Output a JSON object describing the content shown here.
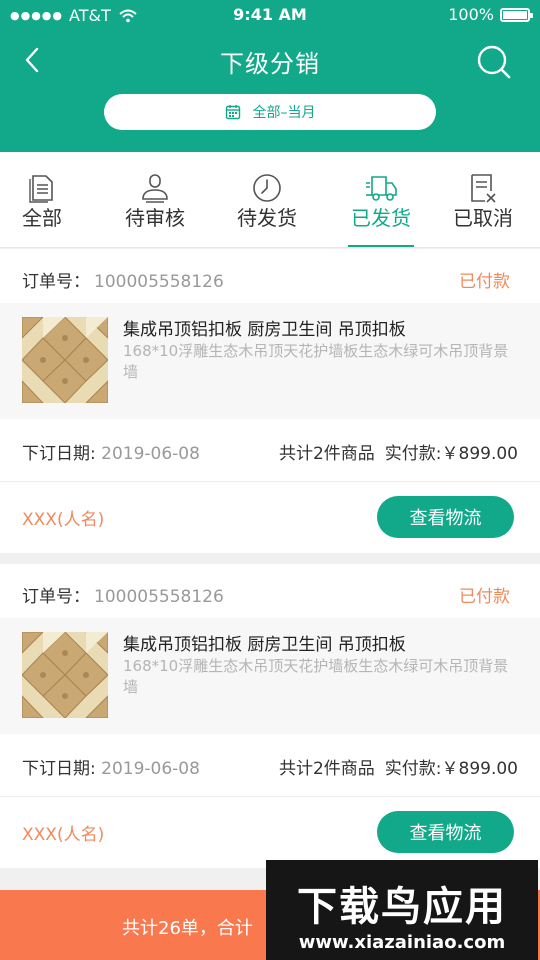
{
  "status_bar": {
    "carrier": "AT&T",
    "time": "9:41 AM",
    "battery": "100%"
  },
  "nav": {
    "title": "下级分销",
    "back_icon": "chevron-left-icon",
    "search_icon": "search-icon"
  },
  "date_filter": {
    "label": "全部–当月",
    "icon": "calendar-icon"
  },
  "tabs": [
    {
      "label": "全部",
      "icon": "document-icon",
      "active": false
    },
    {
      "label": "待审核",
      "icon": "user-check-icon",
      "active": false
    },
    {
      "label": "待发货",
      "icon": "clock-icon",
      "active": false
    },
    {
      "label": "已发货",
      "icon": "truck-icon",
      "active": true
    },
    {
      "label": "已取消",
      "icon": "cancel-document-icon",
      "active": false
    }
  ],
  "orders": [
    {
      "order_label": "订单号：",
      "order_no": "100005558126",
      "status": "已付款",
      "product_title": "集成吊顶铝扣板 厨房卫生间 吊顶扣板",
      "product_desc": "168*10浮雕生态木吊顶天花护墙板生态木绿可木吊顶背景墙",
      "date_label": "下订日期:",
      "date_value": "2019-06-08",
      "count_text": "共计2件商品",
      "pay_text": "实付款:￥899.00",
      "buyer": "XXX(人名)",
      "logistics_button": "查看物流"
    },
    {
      "order_label": "订单号：",
      "order_no": "100005558126",
      "status": "已付款",
      "product_title": "集成吊顶铝扣板 厨房卫生间 吊顶扣板",
      "product_desc": "168*10浮雕生态木吊顶天花护墙板生态木绿可木吊顶背景墙",
      "date_label": "下订日期:",
      "date_value": "2019-06-08",
      "count_text": "共计2件商品",
      "pay_text": "实付款:￥899.00",
      "buyer": "XXX(人名)",
      "logistics_button": "查看物流"
    }
  ],
  "footer": {
    "summary": "共计26单，合计"
  },
  "watermark": {
    "logo": "下载鸟应用",
    "url": "www.xiazainiao.com"
  },
  "colors": {
    "primary": "#12a98a",
    "accent": "#f08a5d",
    "footer": "#f9784d"
  }
}
